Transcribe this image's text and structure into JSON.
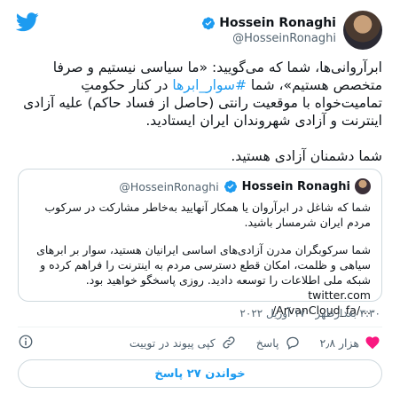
{
  "author": {
    "name": "Hossein Ronaghi",
    "handle": "@HosseinRonaghi"
  },
  "tweet": {
    "text_before_link": "ابرآروانی‌ها، شما که می‌گویید: «ما سیاسی نیستیم و صرفا متخصص هستیم»، شما ",
    "hashtag": "#سوار_ابرها",
    "text_after_link": " در کنار حکومتِ تمامیت‌خواه با موقعیت رانتی (حاصل از فساد حاکم) علیه آزادی اینترنت و آزادی شهروندان ایران ایستادید.",
    "paragraph2": "شما دشمنان آزادی هستید."
  },
  "quoted": {
    "name": "Hossein Ronaghi",
    "handle": "@HosseinRonaghi",
    "paragraph1": "شما که شاغل در ابرآروان یا همکار آنهایید به‌خاطر مشارکت در سرکوب مردم ایران شرمسار باشید.",
    "paragraph2": "شما سرکوبگران مدرن آزادی‌های اساسی ایرانیان هستید، سوار بر ابرهای سیاهی و ظلمت، امکان قطع دسترسی مردم به اینترنت را فراهم کرده و شبکه ملی اطلاعات را توسعه دادید. روزی پاسخگو خواهید بود.",
    "url_line1": "twitter.com",
    "url_line2": "/ArvanCloud_fa/..."
  },
  "meta": {
    "timestamp": "۳:۳۰ بعدازظهر · ۱۷ آوریل ۲۰۲۲"
  },
  "actions": {
    "like_count": "۲٫۸ هزار",
    "reply_label": "پاسخ",
    "copy_link_label": "کپی پیوند در توییت"
  },
  "read_replies_label": "خواندن ۲۷ پاسخ",
  "colors": {
    "accent": "#1d9bf0",
    "like": "#f91880",
    "text": "#0f1419",
    "muted": "#536471"
  },
  "icons": [
    "twitter-logo-icon",
    "verified-badge-icon",
    "heart-icon",
    "reply-icon",
    "link-icon",
    "info-icon"
  ]
}
